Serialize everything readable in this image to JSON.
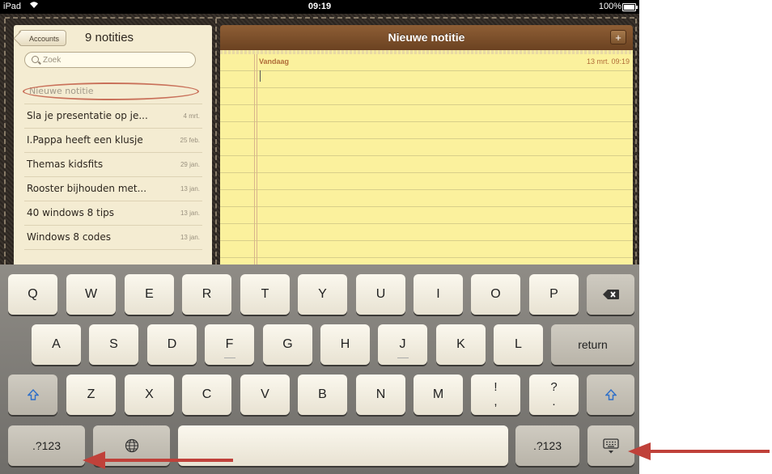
{
  "status_bar": {
    "carrier": "iPad",
    "time": "09:19",
    "battery": "100%"
  },
  "sidebar": {
    "accounts_label": "Accounts",
    "notes_count": "9 notities",
    "search_placeholder": "Zoek",
    "new_note_label": "Nieuwe notitie",
    "items": [
      {
        "title": "Sla je presentatie op je...",
        "date": "4 mrt."
      },
      {
        "title": "I.Pappa heeft een klusje",
        "date": "25 feb."
      },
      {
        "title": "Themas kidsfits",
        "date": "29 jan."
      },
      {
        "title": "Rooster bijhouden met...",
        "date": "13 jan."
      },
      {
        "title": "40 windows 8 tips",
        "date": "13 jan."
      },
      {
        "title": "Windows 8 codes",
        "date": "13 jan."
      }
    ]
  },
  "note": {
    "title": "Nieuwe notitie",
    "add_label": "+",
    "day": "Vandaag",
    "datetime": "13 mrt.  09:19"
  },
  "keyboard": {
    "row1": [
      "Q",
      "W",
      "E",
      "R",
      "T",
      "Y",
      "U",
      "I",
      "O",
      "P"
    ],
    "row2": [
      "A",
      "S",
      "D",
      "F",
      "G",
      "H",
      "J",
      "K",
      "L"
    ],
    "return_label": "return",
    "row3": [
      "Z",
      "X",
      "C",
      "V",
      "B",
      "N",
      "M"
    ],
    "exclam_comma": [
      "!",
      ","
    ],
    "question_period": [
      "?",
      "."
    ],
    "numbers_label": ".?123",
    "icons": {
      "delete": "delete-icon",
      "shift": "shift-icon",
      "globe": "globe-icon",
      "hide_keyboard": "hide-keyboard-icon"
    }
  },
  "annotations": {
    "arrow_color": "#c0413a"
  }
}
